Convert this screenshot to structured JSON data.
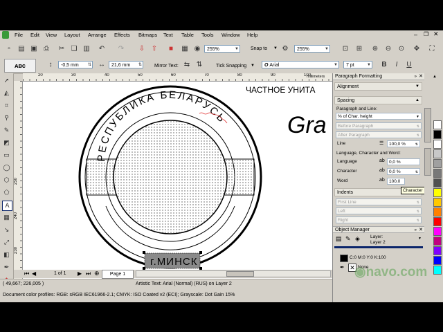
{
  "menu": {
    "items": [
      "File",
      "Edit",
      "View",
      "Layout",
      "Arrange",
      "Effects",
      "Bitmaps",
      "Text",
      "Table",
      "Tools",
      "Window",
      "Help"
    ]
  },
  "toolbar": {
    "zoom_level": "255%",
    "snap_to": "Snap to",
    "zoom_level_2": "255%"
  },
  "property_bar": {
    "x_value": "-0,5 mm",
    "width_value": "21,6 mm",
    "mirror_text_label": "Mirror Text:",
    "tick_snapping_label": "Tick Snapping",
    "font_name": "Arial",
    "font_size": "7 pt"
  },
  "ruler": {
    "unit": "millimeters",
    "h_ticks": [
      "20",
      "30",
      "40",
      "50",
      "60",
      "70",
      "80",
      "90",
      "100"
    ],
    "v_ticks": [
      "250",
      "240",
      "230"
    ]
  },
  "canvas": {
    "stamp_top_text": "РЕСПУБЛИКА БЕЛАРУСЬ",
    "stamp_bottom_text": "г.МИНСК",
    "header_text": "ЧАСТНОЕ УНИТА",
    "big_text": "Gra"
  },
  "page_nav": {
    "counter": "1 of 1",
    "page_tab": "Page 1"
  },
  "status": {
    "coords": "( 49,667; 226,005 )",
    "object_info": "Artistic Text: Arial (Normal) (RUS) on Layer 2",
    "color_profiles": "Document color profiles: RGB: sRGB IEC61966-2.1; CMYK: ISO Coated v2 (ECI); Grayscale: Dot Gain 15%",
    "fill_info": "C:0 M:0 Y:0 K:100",
    "outline_info": "None"
  },
  "docker": {
    "title": "Paragraph Formatting",
    "alignment_label": "Alignment",
    "spacing_label": "Spacing",
    "para_line_label": "Paragraph and Line:",
    "spacing_mode": "% of Char. height",
    "before_paragraph": "Before Paragraph",
    "after_paragraph": "After Paragraph",
    "line_label": "Line",
    "line_value": "100,0 %",
    "lang_char_word_label": "Language, Character and Word:",
    "language_label": "Language",
    "language_value": "0,0 %",
    "character_label": "Character",
    "character_value": "0,0 %",
    "word_label": "Word",
    "word_value": "100,0",
    "tooltip": "Character Spacing",
    "indents_label": "Indents",
    "first_line": "First Line",
    "left": "Left",
    "right": "Right",
    "object_manager_title": "Object Manager",
    "layer_label": "Layer:",
    "layer_value": "Layer 2"
  },
  "watermark": "navo.com",
  "colors": {
    "app_bg": "#d4d0c8",
    "accent_blue": "#0a246a",
    "stamp_dots": "#555555"
  },
  "palette_colors": [
    "#ffffff",
    "#000000",
    "#ffffff",
    "#c8c8c8",
    "#a0a0a0",
    "#787878",
    "#505050",
    "#ffff00",
    "#ffc800",
    "#ff8000",
    "#ff0000",
    "#ff00ff",
    "#c00080",
    "#8000ff",
    "#0000ff",
    "#00ffff"
  ]
}
